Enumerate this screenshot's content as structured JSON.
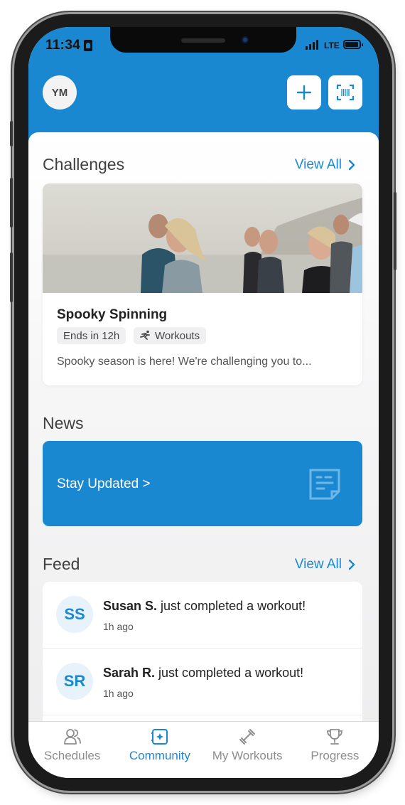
{
  "status_bar": {
    "time": "11:34",
    "network": "LTE"
  },
  "header": {
    "user_initials": "YM",
    "add_icon": "plus-icon",
    "scan_icon": "barcode-scan-icon"
  },
  "challenges": {
    "title": "Challenges",
    "view_all": "View All",
    "card": {
      "image": "group-running-on-beach-photo",
      "title": "Spooky Spinning",
      "ends_label": "Ends in 12h",
      "category_icon": "running-icon",
      "category_label": "Workouts",
      "description": "Spooky season is here! We're challenging you to..."
    }
  },
  "news": {
    "title": "News",
    "banner_label": "Stay Updated >",
    "banner_icon": "note-icon"
  },
  "feed": {
    "title": "Feed",
    "view_all": "View All",
    "items": [
      {
        "initials": "SS",
        "name": "Susan S.",
        "action": " just completed a workout!",
        "time": "1h ago"
      },
      {
        "initials": "SR",
        "name": "Sarah R.",
        "action": " just completed a workout!",
        "time": "1h ago"
      }
    ]
  },
  "tabbar": {
    "tabs": [
      {
        "label": "Schedules",
        "icon": "people-icon",
        "active": false
      },
      {
        "label": "Community",
        "icon": "community-icon",
        "active": true
      },
      {
        "label": "My Workouts",
        "icon": "dumbbell-icon",
        "active": false
      },
      {
        "label": "Progress",
        "icon": "trophy-icon",
        "active": false
      }
    ]
  },
  "colors": {
    "brand": "#1a88d0",
    "text": "#3f3f3f",
    "muted": "#8e8e8e"
  }
}
